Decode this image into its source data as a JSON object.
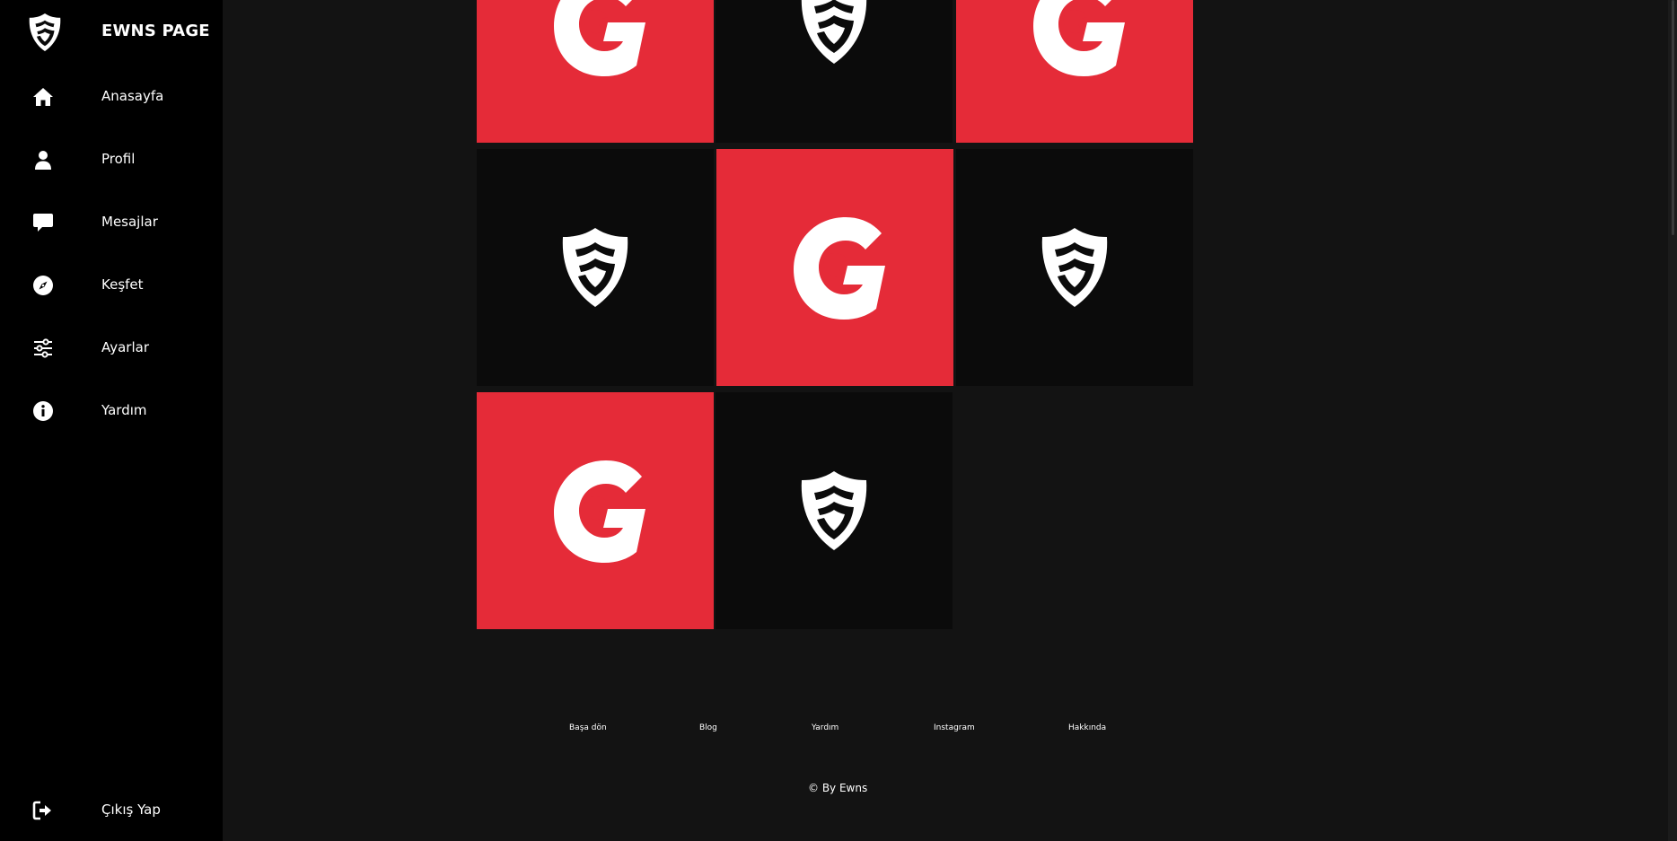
{
  "brand": {
    "title": "EWNS PAGE"
  },
  "sidebar": {
    "items": [
      {
        "label": "Anasayfa",
        "icon": "home-icon"
      },
      {
        "label": "Profil",
        "icon": "user-icon"
      },
      {
        "label": "Mesajlar",
        "icon": "message-icon"
      },
      {
        "label": "Keşfet",
        "icon": "compass-icon"
      },
      {
        "label": "Ayarlar",
        "icon": "sliders-icon"
      },
      {
        "label": "Yardım",
        "icon": "info-icon"
      }
    ],
    "logout": {
      "label": "Çıkış Yap",
      "icon": "logout-icon"
    }
  },
  "gallery": {
    "tiles": [
      {
        "style": "red",
        "logo": "g-logo"
      },
      {
        "style": "dark",
        "logo": "shield-logo"
      },
      {
        "style": "red",
        "logo": "g-logo"
      },
      {
        "style": "dark",
        "logo": "shield-logo"
      },
      {
        "style": "red",
        "logo": "g-logo"
      },
      {
        "style": "dark",
        "logo": "shield-logo"
      },
      {
        "style": "red",
        "logo": "g-logo"
      },
      {
        "style": "dark",
        "logo": "shield-logo"
      }
    ]
  },
  "footer": {
    "links": [
      "Başa dön",
      "Blog",
      "Yardım",
      "Instagram",
      "Hakkında"
    ],
    "copyright": "© By Ewns"
  },
  "colors": {
    "accent": "#e52b38",
    "background": "#131313",
    "sidebar": "#000000",
    "tile_dark": "#0b0b0b"
  }
}
